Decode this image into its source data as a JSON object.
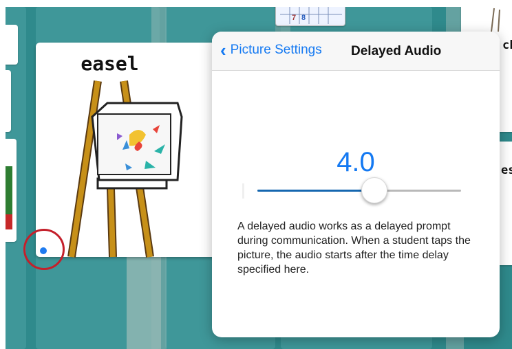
{
  "card": {
    "label": "easel"
  },
  "side_labels": {
    "top_right": "cke",
    "mid_right": "esk"
  },
  "popover": {
    "back_label": "Picture Settings",
    "title": "Delayed Audio",
    "value": "4.0",
    "slider_fraction": 0.57,
    "description": "A delayed audio works as a delayed prompt during communication. When a student taps the picture, the audio starts after the time delay specified here."
  },
  "calendar_digits": [
    "7",
    "8"
  ],
  "colors": {
    "accent": "#1479f2",
    "board_teal": "#2f8a8c",
    "highlight_ring": "#c4202b",
    "slider_fill": "#1567b0"
  }
}
